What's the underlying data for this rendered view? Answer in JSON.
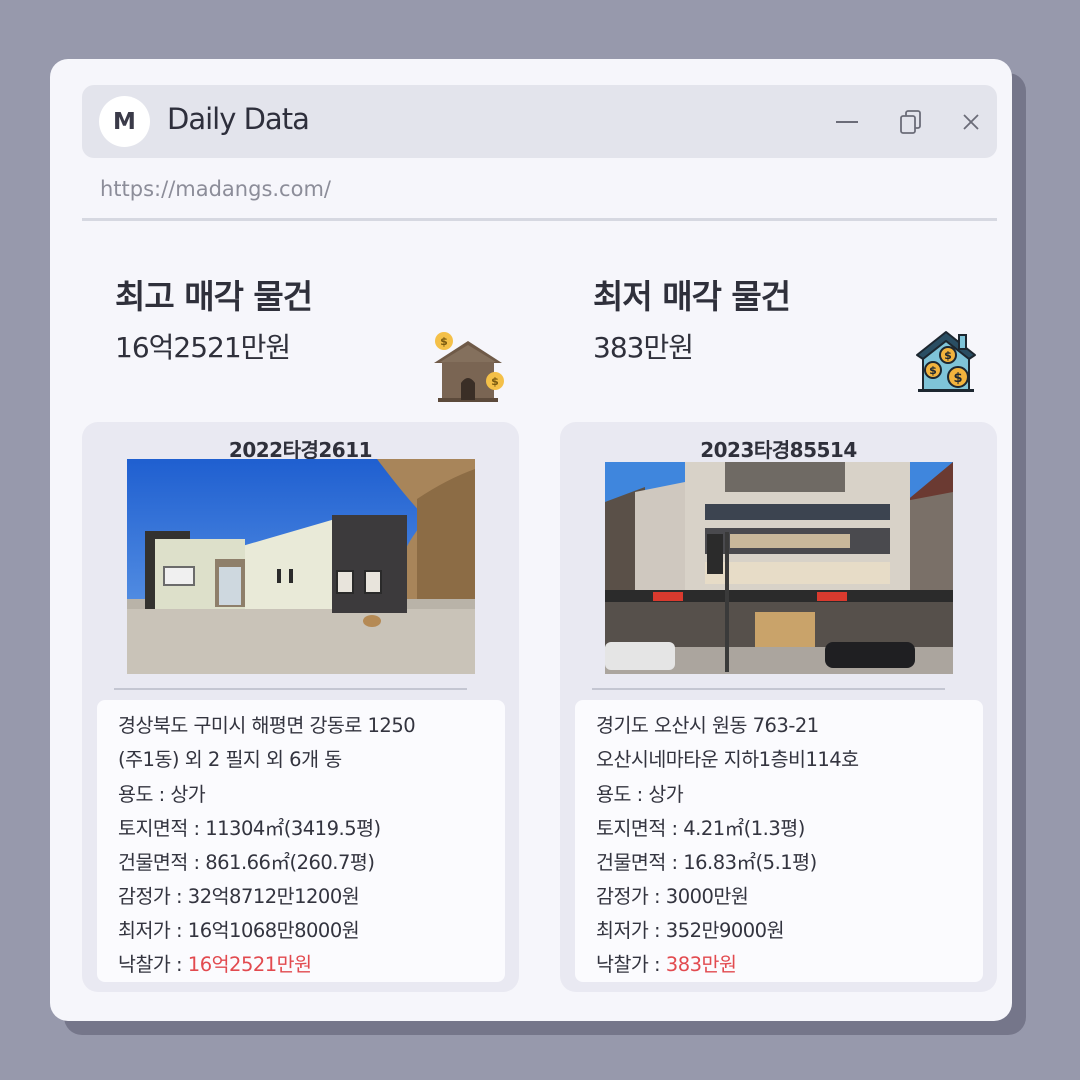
{
  "app": {
    "logo_letter": "M",
    "title": "Daily Data",
    "url": "https://madangs.com/"
  },
  "highest": {
    "heading": "최고 매각 물건",
    "price": "16억2521만원",
    "case_no": "2022타경2611",
    "icon": "house-coins-icon",
    "address_line1": "경상북도 구미시 해평면 강동로 1250",
    "address_line2": "(주1동) 외 2 필지 외 6개 동",
    "usage": "용도 : 상가",
    "land_area": "토지면적 : 11304㎡(3419.5평)",
    "building_area": "건물면적 : 861.66㎡(260.7평)",
    "appraisal": "감정가 : 32억8712만1200원",
    "minimum": "최저가 : 16억1068만8000원",
    "winning_label": "낙찰가 : ",
    "winning_value": "16억2521만원"
  },
  "lowest": {
    "heading": "최저 매각 물건",
    "price": "383만원",
    "case_no": "2023타경85514",
    "icon": "house-dollar-icon",
    "address_line1": "경기도 오산시 원동 763-21",
    "address_line2": "오산시네마타운 지하1층비114호",
    "usage": "용도 : 상가",
    "land_area": "토지면적 : 4.21㎡(1.3평)",
    "building_area": "건물면적 : 16.83㎡(5.1평)",
    "appraisal": "감정가 : 3000만원",
    "minimum": "최저가 : 352만9000원",
    "winning_label": "낙찰가 : ",
    "winning_value": "383만원"
  },
  "colors": {
    "background": "#9799ac",
    "window": "#f6f6fb",
    "titlebar": "#e3e4ec",
    "card": "#e9e9f2",
    "highlight_red": "#e24a4f"
  }
}
